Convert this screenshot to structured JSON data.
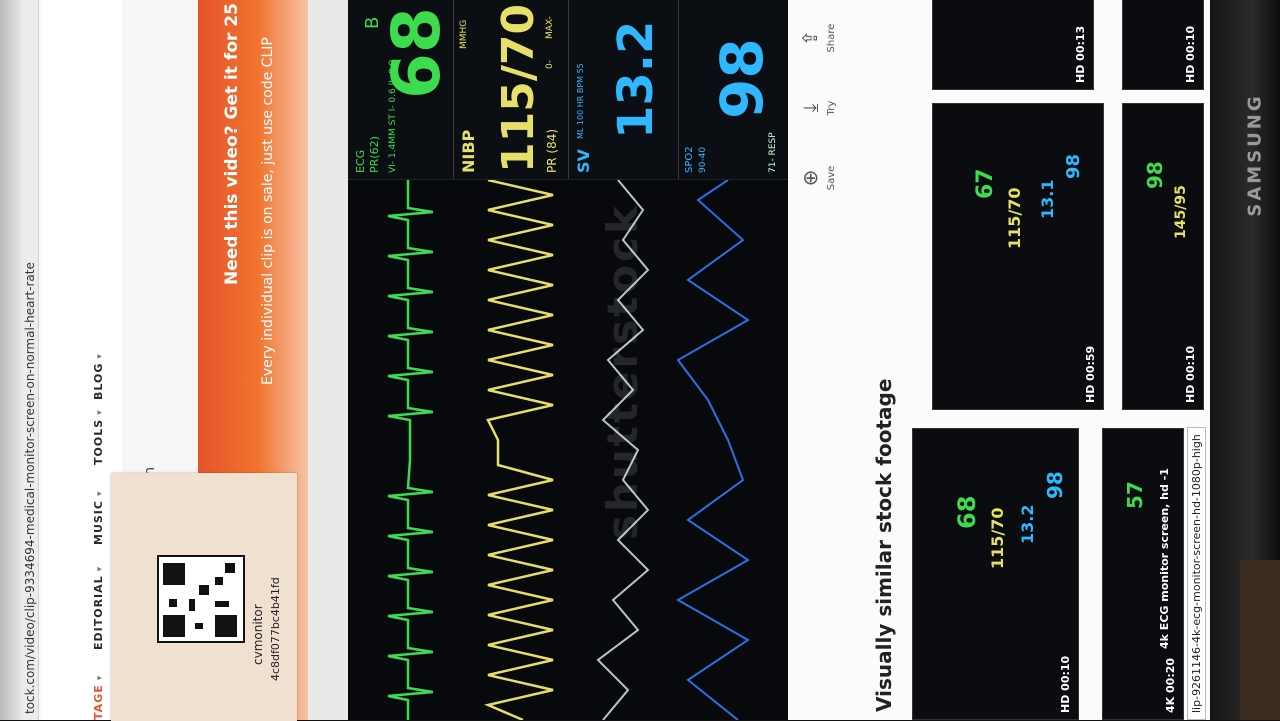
{
  "browser": {
    "url": "tock.com/video/clip-9334694-medical-monitor-screen-on-normal-heart-rate"
  },
  "nav": {
    "items": [
      {
        "label": "TAGE",
        "accent": true
      },
      {
        "label": "EDITORIAL"
      },
      {
        "label": "MUSIC"
      },
      {
        "label": "TOOLS"
      },
      {
        "label": "BLOG"
      }
    ]
  },
  "page": {
    "left_text_1": "ection",
    "left_text_2": "eadi"
  },
  "promo": {
    "headline": "Need this video? Get it for 25",
    "subline": "Every individual clip is on sale, just use code CLIP"
  },
  "monitor": {
    "hr_label": "B",
    "hr_value": "68",
    "ecg_label": "ECG",
    "pr_value": "PR(62)",
    "ecg_sub": "VI- 1.4MM  ST I- 0.6  II- 0.9",
    "nibp_label": "NIBP",
    "nibp_unit": "MMHG",
    "nibp_value": "115/70",
    "nibp_pr": "PR (84)",
    "nibp_scale_low": "0-",
    "nibp_scale_high": "MAX-",
    "sv_label": "SV",
    "sv_sub": "ML  100  HR BPM 55",
    "sv_value": "13.2",
    "spo2_label": "SPO2",
    "spo2_sub": "90-40",
    "spo2_value": "98",
    "resp_label": "71- RESP",
    "watermark": "shutterstock"
  },
  "actions": [
    {
      "label": "Save",
      "icon": "plus-circle-icon"
    },
    {
      "label": "Try",
      "icon": "download-icon"
    },
    {
      "label": "Share",
      "icon": "share-icon"
    }
  ],
  "similar": {
    "title": "Visually similar stock footage",
    "thumbs": [
      {
        "hd": "HD  00:10",
        "vals": [
          "68",
          "115/70",
          "13.2",
          "98"
        ]
      },
      {
        "hd": "4K  00:20",
        "caption": "4k ECG monitor screen, hd -1",
        "vals": [
          "57"
        ]
      },
      {
        "hd": "HD  00:59",
        "vals": [
          "67",
          "115/70",
          "13.1",
          "98"
        ]
      },
      {
        "hd": "HD  00:10",
        "vals": [
          "98",
          "145/95"
        ]
      },
      {
        "hd": "HD  00:13",
        "vals": []
      },
      {
        "hd": "HD  00:10",
        "vals": []
      }
    ],
    "tooltip": "lip-9261146-4k-ecg-monitor-screen-hd-1080p-high"
  },
  "sticker": {
    "line1": "cvmonitor",
    "line2": "4c8df077bc4b41fd"
  },
  "monitor_brand": "SAMSUNG",
  "colors": {
    "ecg": "#3ddc4f",
    "nibp": "#e6e06a",
    "sv": "#2fb8ff",
    "promo": "#e6532a"
  }
}
